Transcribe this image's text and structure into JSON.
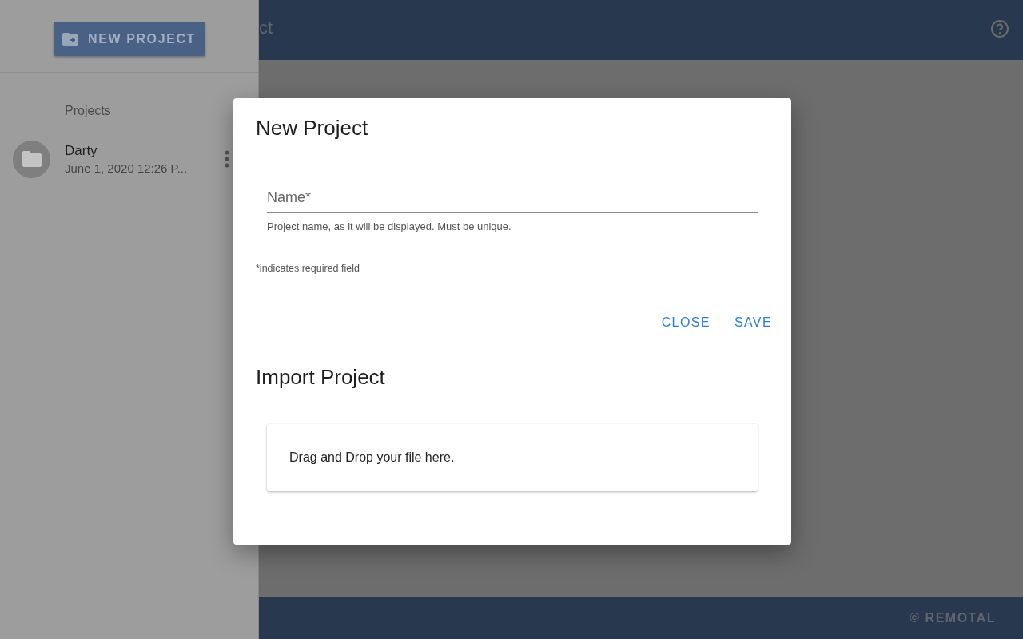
{
  "sidebar": {
    "new_project_button": "NEW PROJECT",
    "section_title": "Projects",
    "projects": [
      {
        "name": "Darty",
        "date": "June 1, 2020 12:26 P..."
      }
    ]
  },
  "header": {
    "title": "ct"
  },
  "footer": {
    "copyright": "© REMOTAL"
  },
  "dialog": {
    "title": "New Project",
    "name_field": {
      "placeholder": "Name*",
      "hint": "Project name, as it will be displayed. Must be unique."
    },
    "required_note": "*indicates required field",
    "buttons": [
      "CLOSE",
      "SAVE"
    ],
    "import": {
      "title": "Import Project",
      "drop_zone": "Drag and Drop your file here."
    }
  }
}
